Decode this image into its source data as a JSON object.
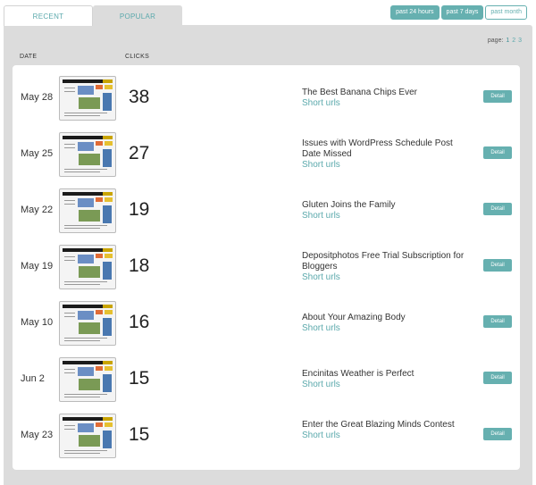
{
  "tabs": [
    {
      "label": "RECENT"
    },
    {
      "label": "POPULAR"
    }
  ],
  "range_buttons": [
    {
      "label": "past 24 hours",
      "active": true
    },
    {
      "label": "past 7 days",
      "active": true
    },
    {
      "label": "past month",
      "active": false
    }
  ],
  "pager": {
    "label": "page:",
    "pages": [
      "1",
      "2",
      "3"
    ],
    "current": "1"
  },
  "headers": {
    "date": "DATE",
    "clicks": "CLICKS"
  },
  "rows": [
    {
      "date": "May 28",
      "clicks": "38",
      "title": "The Best Banana Chips Ever",
      "sub": "Short urls",
      "detail": "Detail"
    },
    {
      "date": "May 25",
      "clicks": "27",
      "title": "Issues with WordPress Schedule Post Date Missed",
      "sub": "Short urls",
      "detail": "Detail"
    },
    {
      "date": "May 22",
      "clicks": "19",
      "title": "Gluten Joins the Family",
      "sub": "Short urls",
      "detail": "Detail"
    },
    {
      "date": "May 19",
      "clicks": "18",
      "title": "Depositphotos Free Trial Subscription for Bloggers",
      "sub": "Short urls",
      "detail": "Detail"
    },
    {
      "date": "May 10",
      "clicks": "16",
      "title": "About Your Amazing Body",
      "sub": "Short urls",
      "detail": "Detail"
    },
    {
      "date": "Jun 2",
      "clicks": "15",
      "title": "Encinitas Weather is Perfect",
      "sub": "Short urls",
      "detail": "Detail"
    },
    {
      "date": "May 23",
      "clicks": "15",
      "title": "Enter the Great Blazing Minds Contest",
      "sub": "Short urls",
      "detail": "Detail"
    }
  ],
  "colors": {
    "accent": "#66b0b0",
    "panel": "#dcdcdc",
    "link": "#5ba9ac"
  }
}
